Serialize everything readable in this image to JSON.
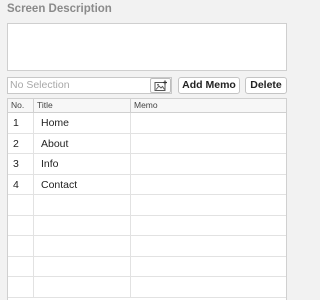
{
  "section": {
    "title": "Screen Description"
  },
  "description": {
    "value": ""
  },
  "toolbar": {
    "selection_placeholder": "No Selection",
    "add_memo_label": "Add Memo",
    "delete_label": "Delete"
  },
  "table": {
    "columns": [
      "No.",
      "Title",
      "Memo"
    ],
    "rows": [
      {
        "no": "1",
        "title": "Home",
        "memo": ""
      },
      {
        "no": "2",
        "title": "About",
        "memo": ""
      },
      {
        "no": "3",
        "title": "Info",
        "memo": ""
      },
      {
        "no": "4",
        "title": "Contact",
        "memo": ""
      },
      {
        "no": "",
        "title": "",
        "memo": ""
      },
      {
        "no": "",
        "title": "",
        "memo": ""
      },
      {
        "no": "",
        "title": "",
        "memo": ""
      },
      {
        "no": "",
        "title": "",
        "memo": ""
      },
      {
        "no": "",
        "title": "",
        "memo": ""
      }
    ]
  }
}
